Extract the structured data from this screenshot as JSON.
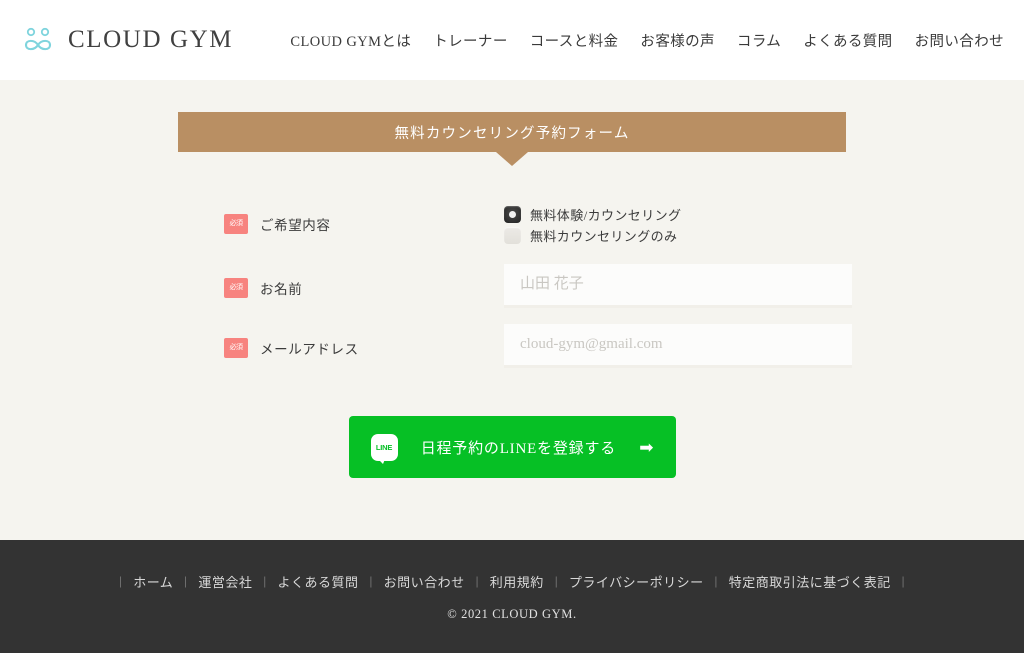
{
  "header": {
    "logo_icon": "infinity-eyes-icon",
    "brand_name": "CLOUD GYM",
    "brand_color": "#7fd4dd",
    "nav": [
      {
        "label": "CLOUD GYMとは"
      },
      {
        "label": "トレーナー"
      },
      {
        "label": "コースと料金"
      },
      {
        "label": "お客様の声"
      },
      {
        "label": "コラム"
      },
      {
        "label": "よくある質問"
      },
      {
        "label": "お問い合わせ"
      }
    ]
  },
  "form": {
    "banner_title": "無料カウンセリング予約フォーム",
    "banner_color": "#b98f63",
    "required_badge": "必須",
    "required_badge_color": "#f7837f",
    "rows": {
      "choice": {
        "label": "ご希望内容",
        "options": [
          {
            "label": "無料体験/カウンセリング",
            "selected": true
          },
          {
            "label": "無料カウンセリングのみ",
            "selected": false
          }
        ]
      },
      "name": {
        "label": "お名前",
        "value": "",
        "placeholder": "山田 花子"
      },
      "email": {
        "label": "メールアドレス",
        "value": "",
        "placeholder": "cloud-gym@gmail.com"
      }
    },
    "cta": {
      "icon": "line-icon",
      "icon_text": "LINE",
      "label": "日程予約のLINEを登録する",
      "arrow_icon": "arrow-right-icon",
      "arrow_glyph": "➡",
      "color": "#06c025"
    }
  },
  "footer": {
    "links": [
      {
        "label": "ホーム"
      },
      {
        "label": "運営会社"
      },
      {
        "label": "よくある質問"
      },
      {
        "label": "お問い合わせ"
      },
      {
        "label": "利用規約"
      },
      {
        "label": "プライバシーポリシー"
      },
      {
        "label": "特定商取引法に基づく表記"
      }
    ],
    "separator": "|",
    "copyright": "© 2021 CLOUD GYM.",
    "background": "#333333"
  }
}
